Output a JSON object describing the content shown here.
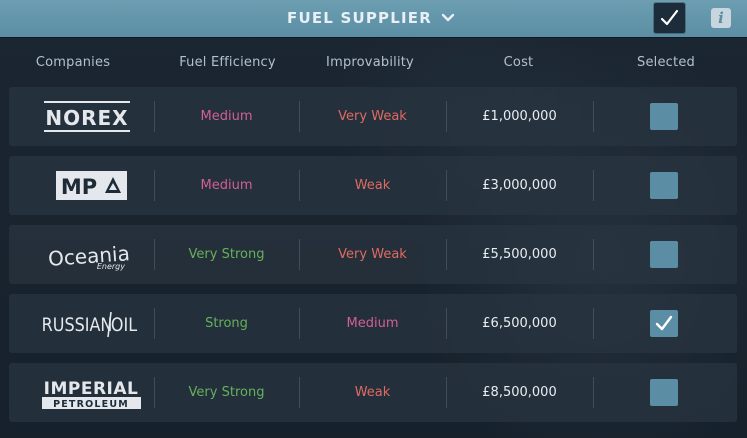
{
  "header": {
    "title": "FUEL SUPPLIER",
    "info_label": "i"
  },
  "columns": {
    "companies": "Companies",
    "efficiency": "Fuel Efficiency",
    "improvability": "Improvability",
    "cost": "Cost",
    "selected": "Selected"
  },
  "rating_colors": {
    "Very Weak": "#e06a62",
    "Weak": "#e06a62",
    "Medium": "#d35f95",
    "Strong": "#66b15d",
    "Very Strong": "#66b15d"
  },
  "rows": [
    {
      "company": "NOREX",
      "logo_text": "NOREX",
      "efficiency": "Medium",
      "improvability": "Very Weak",
      "cost": "£1,000,000",
      "selected": false
    },
    {
      "company": "MP",
      "logo_text": "MP",
      "efficiency": "Medium",
      "improvability": "Weak",
      "cost": "£3,000,000",
      "selected": false
    },
    {
      "company": "Oceania Energy",
      "logo_text": "Oceania",
      "logo_sub": "Energy",
      "efficiency": "Very Strong",
      "improvability": "Very Weak",
      "cost": "£5,500,000",
      "selected": false
    },
    {
      "company": "RUSSIAN OIL",
      "logo_text": "RUSSIAN",
      "logo_text2": "OIL",
      "efficiency": "Strong",
      "improvability": "Medium",
      "cost": "£6,500,000",
      "selected": true
    },
    {
      "company": "IMPERIAL PETROLEUM",
      "logo_text": "IMPERIAL",
      "logo_sub": "PETROLEUM",
      "efficiency": "Very Strong",
      "improvability": "Weak",
      "cost": "£8,500,000",
      "selected": false
    }
  ]
}
